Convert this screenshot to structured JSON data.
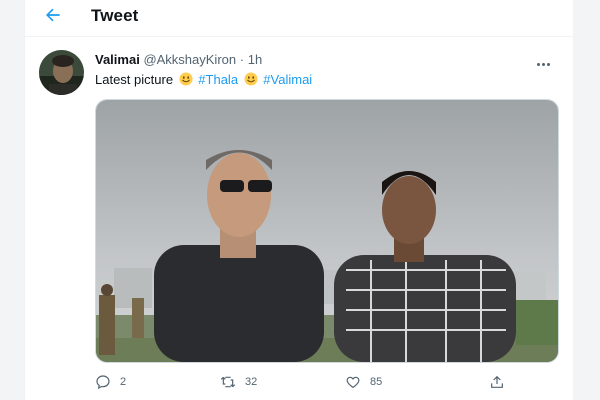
{
  "header": {
    "title": "Tweet",
    "back_icon": "arrow-left-icon"
  },
  "tweet": {
    "name": "Valimai",
    "handle": "@AkkshayKiron",
    "separator": "·",
    "time": "1h",
    "text_prefix": "Latest picture",
    "emoji": "smiling-face-emoji",
    "hashtags": [
      "#Thala",
      "#Valimai"
    ],
    "media_alt": "Photo of two men standing outdoors under a cloudy sky"
  },
  "actions": {
    "replies": "2",
    "retweets": "32",
    "likes": "85"
  },
  "colors": {
    "accent": "#1d9bf0",
    "muted": "#536471"
  }
}
